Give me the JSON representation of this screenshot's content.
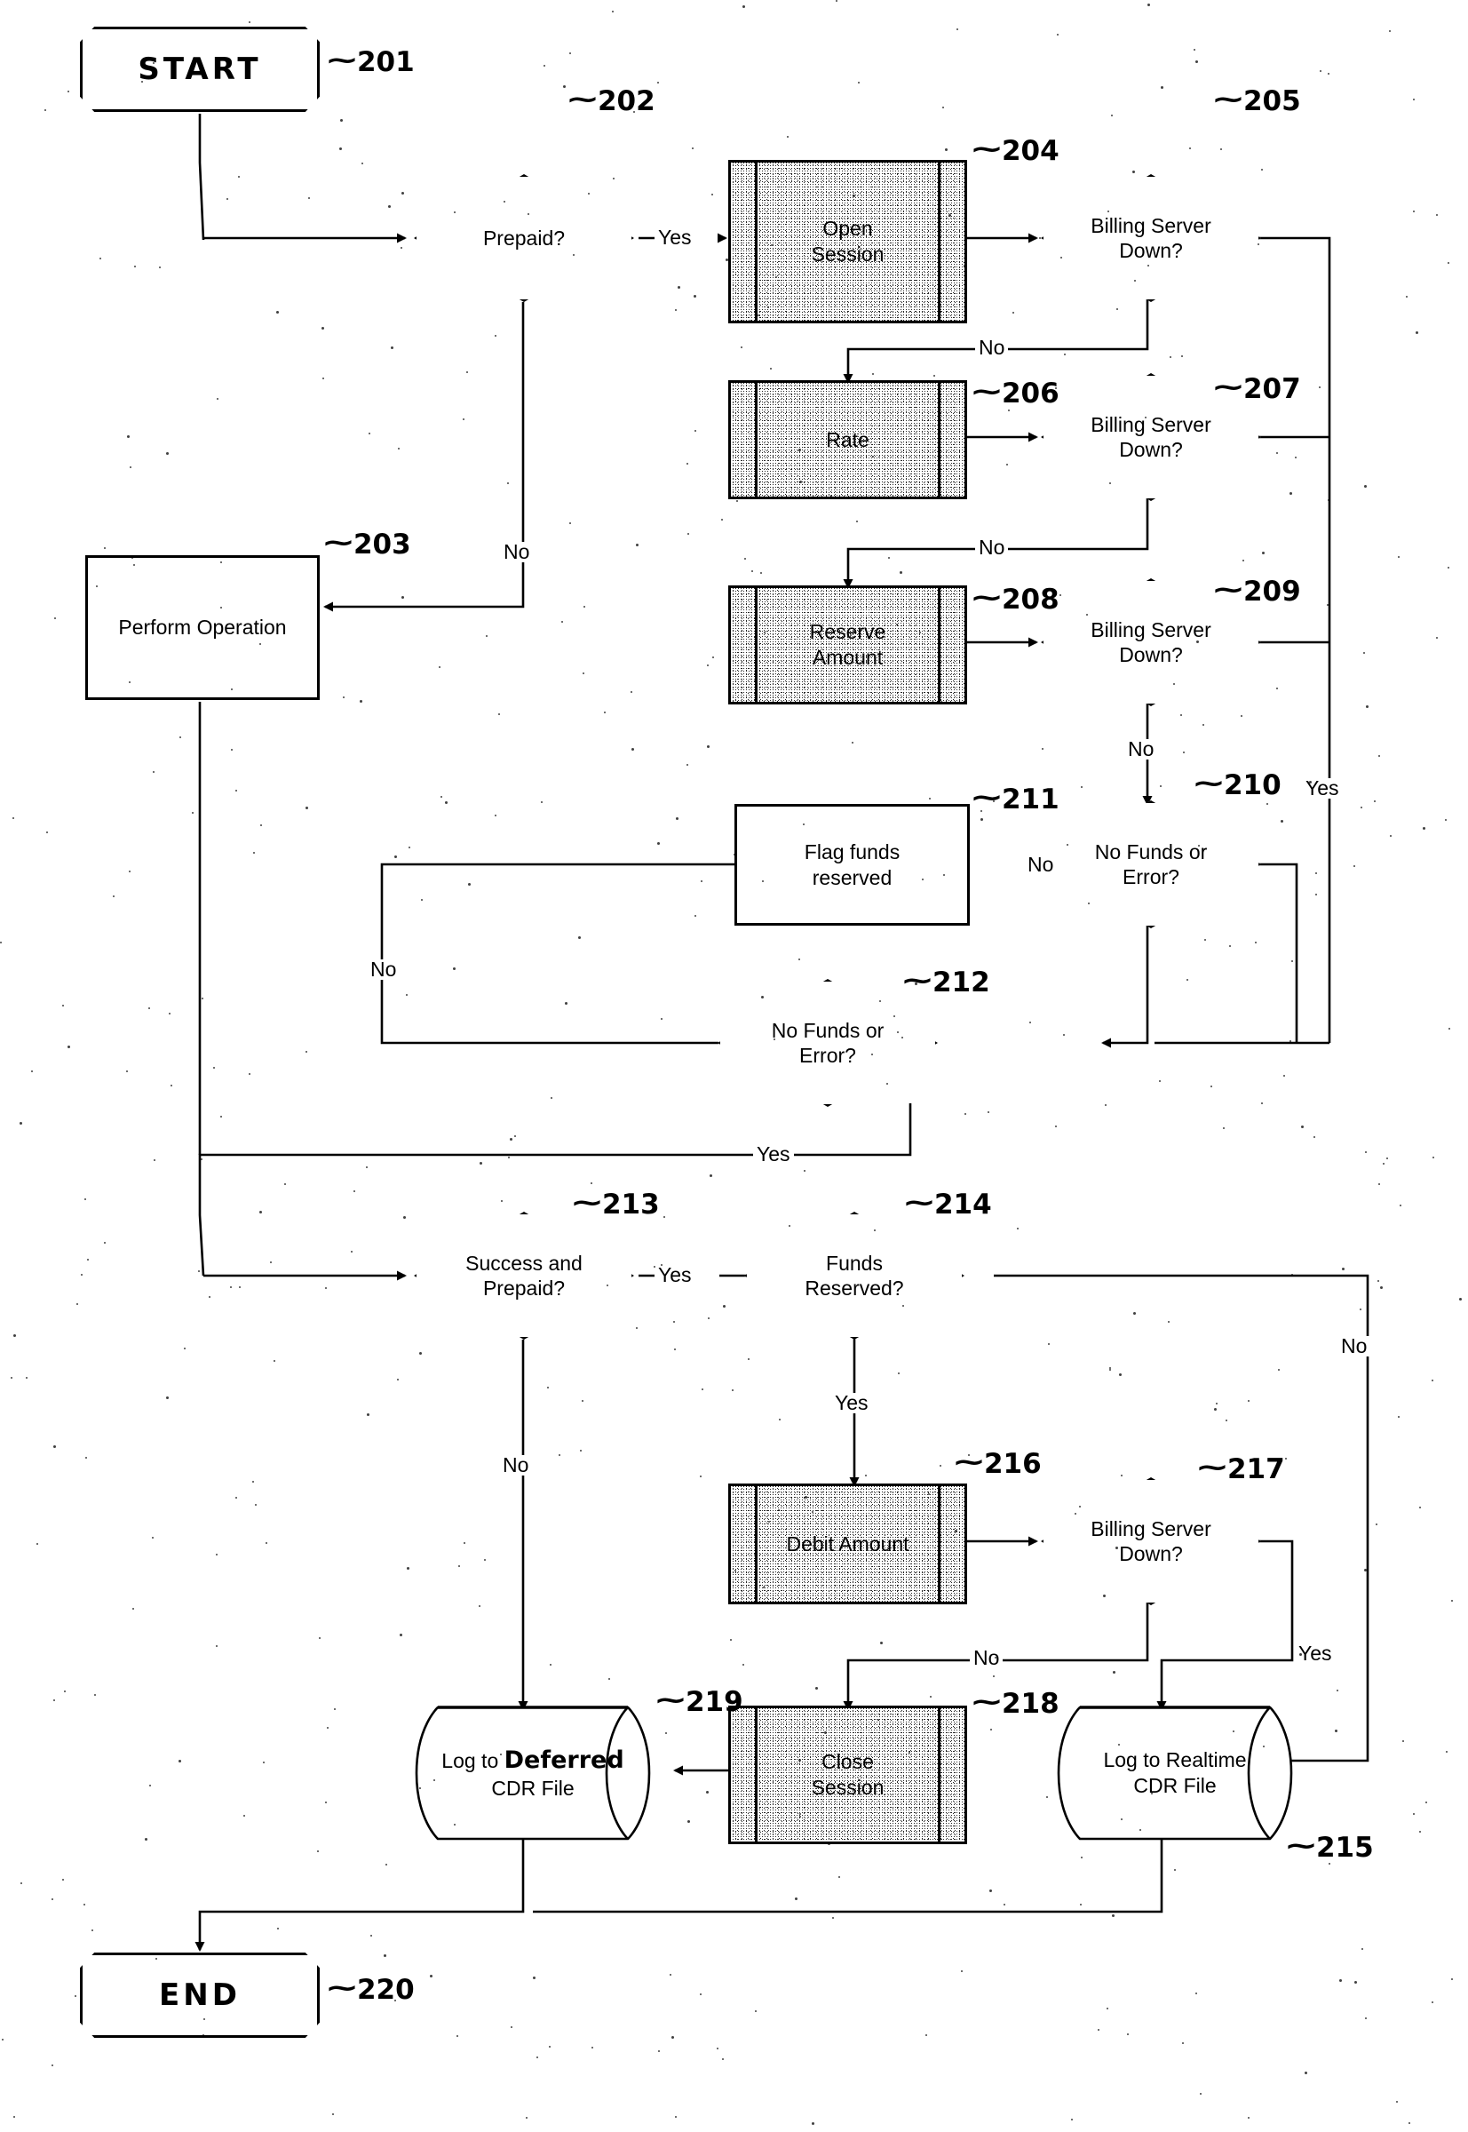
{
  "figure": {
    "type": "patent-flowchart",
    "title": "Prepaid billing session flowchart",
    "handwritten_annotations": true
  },
  "nodes": [
    {
      "id": "start",
      "shape": "terminal",
      "label": "START",
      "ref": "201",
      "handwritten_label": true
    },
    {
      "id": "prepaid",
      "shape": "decision",
      "label": "Prepaid?",
      "ref": "202"
    },
    {
      "id": "perform",
      "shape": "process",
      "label": "Perform Operation",
      "ref": "203"
    },
    {
      "id": "open_session",
      "shape": "predefined-process",
      "label": "Open\nSession",
      "ref": "204"
    },
    {
      "id": "bsd1",
      "shape": "decision",
      "label": "Billing Server\nDown?",
      "ref": "205"
    },
    {
      "id": "rate",
      "shape": "predefined-process",
      "label": "Rate",
      "ref": "206"
    },
    {
      "id": "bsd2",
      "shape": "decision",
      "label": "Billing Server\nDown?",
      "ref": "207"
    },
    {
      "id": "reserve",
      "shape": "predefined-process",
      "label": "Reserve\nAmount",
      "ref": "208"
    },
    {
      "id": "bsd3",
      "shape": "decision",
      "label": "Billing Server\nDown?",
      "ref": "209"
    },
    {
      "id": "nfe1",
      "shape": "decision",
      "label": "No Funds or\nError?",
      "ref": "210"
    },
    {
      "id": "flag",
      "shape": "process",
      "label": "Flag funds\nreserved",
      "ref": "211"
    },
    {
      "id": "nfe2",
      "shape": "decision",
      "label": "No Funds or\nError?",
      "ref": "212"
    },
    {
      "id": "success",
      "shape": "decision",
      "label": "Success and\nPrepaid?",
      "ref": "213"
    },
    {
      "id": "funds_res",
      "shape": "decision",
      "label": "Funds\nReserved?",
      "ref": "214"
    },
    {
      "id": "realtime",
      "shape": "cylinder",
      "label": "Log to Realtime\nCDR File",
      "ref": "215"
    },
    {
      "id": "debit",
      "shape": "predefined-process",
      "label": "Debit Amount",
      "ref": "216"
    },
    {
      "id": "bsd4",
      "shape": "decision",
      "label": "Billing Server\nDown?",
      "ref": "217"
    },
    {
      "id": "close",
      "shape": "predefined-process",
      "label": "Close\nSession",
      "ref": "218"
    },
    {
      "id": "deferred",
      "shape": "cylinder",
      "label_pre": "Log to ",
      "label_hand": "Deferred",
      "label_post": "CDR File",
      "ref": "219"
    },
    {
      "id": "end",
      "shape": "terminal",
      "label": "END",
      "ref": "220",
      "handwritten_label": true
    }
  ],
  "labels": {
    "start": "START",
    "end": "END",
    "prepaid": "Prepaid?",
    "perform_operation": "Perform Operation",
    "open_session_1": "Open",
    "open_session_2": "Session",
    "rate": "Rate",
    "reserve_1": "Reserve",
    "reserve_2": "Amount",
    "billing_server_1": "Billing Server",
    "billing_server_2": "Down?",
    "no_funds_1": "No Funds or",
    "no_funds_2": "Error?",
    "flag_1": "Flag funds",
    "flag_2": "reserved",
    "success_1": "Success and",
    "success_2": "Prepaid?",
    "funds_1": "Funds",
    "funds_2": "Reserved?",
    "debit": "Debit Amount",
    "close_1": "Close",
    "close_2": "Session",
    "deferred_pre": "Log to ",
    "deferred_hand": "Deferred",
    "deferred_post": "CDR File",
    "realtime_1": "Log to Realtime",
    "realtime_2": "CDR File"
  },
  "refs": {
    "r201": "201",
    "r202": "202",
    "r203": "203",
    "r204": "204",
    "r205": "205",
    "r206": "206",
    "r207": "207",
    "r208": "208",
    "r209": "209",
    "r210": "210",
    "r211": "211",
    "r212": "212",
    "r213": "213",
    "r214": "214",
    "r215": "215",
    "r216": "216",
    "r217": "217",
    "r218": "218",
    "r219": "219",
    "r220": "220"
  },
  "edge_labels": {
    "yes": "Yes",
    "no": "No",
    "prepaid_yes": "Yes",
    "prepaid_no": "No",
    "bsd1_no": "No",
    "bsd2_no": "No",
    "bsd3_no": "No",
    "nfe1_yes": "Yes",
    "nfe1_no": "No",
    "nfe2_yes": "Yes",
    "nfe2_no": "No",
    "success_yes": "Yes",
    "success_no": "No",
    "funds_yes": "Yes",
    "funds_no": "No",
    "bsd4_no": "No",
    "bsd4_yes": "Yes"
  },
  "colors": {
    "ink": "#000000",
    "paper": "#ffffff"
  }
}
